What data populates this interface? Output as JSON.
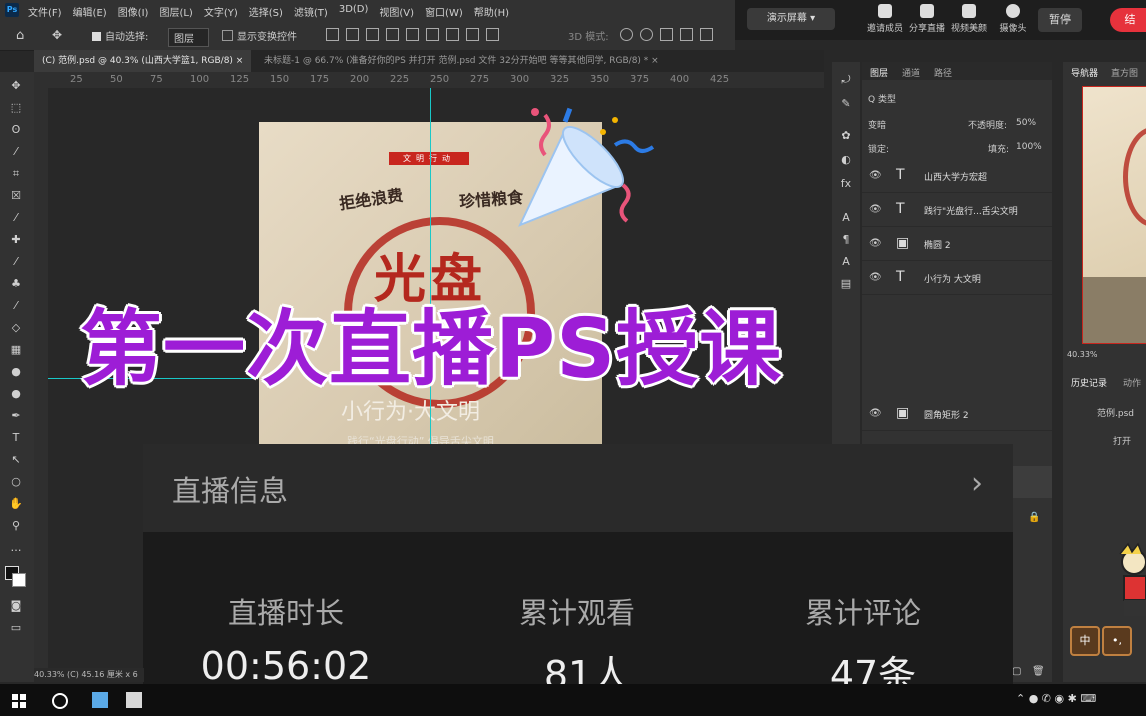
{
  "app": {
    "menu": [
      "文件(F)",
      "编辑(E)",
      "图像(I)",
      "图层(L)",
      "文字(Y)",
      "选择(S)",
      "滤镜(T)",
      "3D(D)",
      "视图(V)",
      "窗口(W)",
      "帮助(H)"
    ]
  },
  "live_bar": {
    "present_label": "演示屏幕 ▾",
    "tools": [
      "邀请成员",
      "分享直播",
      "视频美颜",
      "摄像头"
    ],
    "pause_label": "暂停",
    "end_label": "结"
  },
  "options_bar": {
    "auto_select_label": "自动选择:",
    "auto_select_value": "图层",
    "transform_label": "显示变换控件",
    "mode_3d_label": "3D 模式:"
  },
  "tabs": [
    {
      "label": "(C) 范例.psd @ 40.3% (山西大学篮1, RGB/8) ×"
    },
    {
      "label": "未标题-1 @ 66.7% (准备好你的PS 并打开 范例.psd 文件 32分开始吧 等等其他同学, RGB/8) * ×"
    }
  ],
  "ruler": {
    "h_ticks": [
      "25",
      "50",
      "75",
      "100",
      "125",
      "150",
      "175",
      "200",
      "225",
      "250",
      "275",
      "300",
      "325",
      "350",
      "375",
      "400",
      "425"
    ]
  },
  "poster": {
    "banner": "文明行动",
    "line1a": "拒绝浪费",
    "line1b": "珍惜粮食",
    "big": "光盘",
    "sub": "小行为·大文明",
    "sub2": "践行“光盘行动” 倡导舌尖文明"
  },
  "overlay_title": "第一次直播PS授课",
  "layers_panel": {
    "tabs": [
      "图层",
      "通道",
      "路径"
    ],
    "filter_label": "Q 类型",
    "blend_mode": "变暗",
    "opacity_label": "不透明度:",
    "opacity_value": "50%",
    "lock_label": "锁定:",
    "fill_label": "填充:",
    "fill_value": "100%",
    "layers": [
      {
        "type": "T",
        "name": "山西大学方宏超"
      },
      {
        "type": "T",
        "name": "践行\"光盘行...舌尖文明"
      },
      {
        "type": "▣",
        "name": "椭圆 2"
      },
      {
        "type": "T",
        "name": "小行为 大文明"
      },
      {
        "type": "▣",
        "name": "圆角矩形 2"
      }
    ]
  },
  "navigator": {
    "tabs": [
      "导航器",
      "直方图"
    ],
    "zoom": "40.33%",
    "history_tabs": [
      "历史记录",
      "动作"
    ],
    "history_file": "范例.psd",
    "history_open": "打开"
  },
  "live_info": {
    "header": "直播信息",
    "stats": [
      {
        "label": "直播时长",
        "value": "00:56:02"
      },
      {
        "label": "累计观看",
        "value": "81人"
      },
      {
        "label": "累计评论",
        "value": "47条"
      }
    ]
  },
  "status_bar": {
    "text": "40.33%   (C) 45.16 厘米 x 6"
  },
  "chips": [
    "中",
    "•,"
  ],
  "colors": {
    "title_purple": "#9d1dd6",
    "end_red": "#e6323c",
    "guide_cyan": "#19c8c8"
  }
}
